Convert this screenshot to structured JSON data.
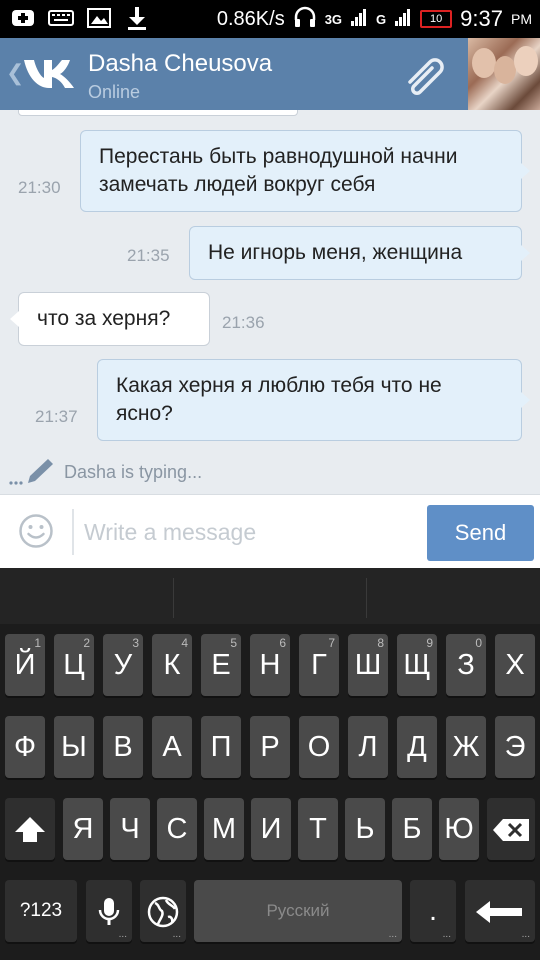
{
  "status_bar": {
    "speed": "0.86K/s",
    "network_3g": "3G",
    "network_g": "G",
    "battery": "10",
    "time": "9:37",
    "ampm": "PM"
  },
  "header": {
    "contact_name": "Dasha Cheusova",
    "contact_status": "Online"
  },
  "messages": [
    {
      "direction": "out",
      "text": "Перестань быть равнодушной начни замечать людей вокруг себя",
      "time": "21:30"
    },
    {
      "direction": "out",
      "text": "Не игнорь меня, женщина",
      "time": "21:35"
    },
    {
      "direction": "in",
      "text": "что за херня?",
      "time": "21:36"
    },
    {
      "direction": "out",
      "text": "Какая херня я люблю тебя что не ясно?",
      "time": "21:37"
    }
  ],
  "typing_indicator": "Dasha is typing...",
  "composer": {
    "placeholder": "Write a message",
    "send_label": "Send"
  },
  "keyboard": {
    "row1": [
      {
        "label": "Й",
        "hint": "1"
      },
      {
        "label": "Ц",
        "hint": "2"
      },
      {
        "label": "У",
        "hint": "3"
      },
      {
        "label": "К",
        "hint": "4"
      },
      {
        "label": "Е",
        "hint": "5"
      },
      {
        "label": "Н",
        "hint": "6"
      },
      {
        "label": "Г",
        "hint": "7"
      },
      {
        "label": "Ш",
        "hint": "8"
      },
      {
        "label": "Щ",
        "hint": "9"
      },
      {
        "label": "З",
        "hint": "0"
      },
      {
        "label": "Х",
        "hint": ""
      }
    ],
    "row2": [
      "Ф",
      "Ы",
      "В",
      "А",
      "П",
      "Р",
      "О",
      "Л",
      "Д",
      "Ж",
      "Э"
    ],
    "row3": [
      "Я",
      "Ч",
      "С",
      "М",
      "И",
      "Т",
      "Ь",
      "Б",
      "Ю"
    ],
    "symbols_label": "?123",
    "space_label": "Русский",
    "period_label": "."
  }
}
